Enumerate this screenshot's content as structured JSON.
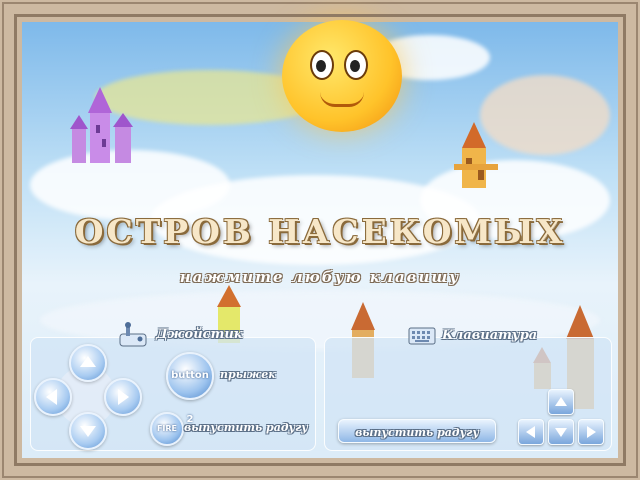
{
  "title": "ОСТРОВ НАСЕКОМЫХ",
  "subtitle": "нажмите любую клавишу",
  "joystick": {
    "heading": "Джойстик",
    "jump_button": "button 2",
    "jump_label": "прыжек",
    "fire_button": "FIRE",
    "fire_label": "выпустить радугу"
  },
  "keyboard": {
    "heading": "Клавиатура",
    "fire_button_label": "выпустить радугу"
  },
  "icons": {
    "joystick": "joystick-icon",
    "keyboard": "keyboard-icon",
    "sun": "sun-character",
    "castle": "castle-icon"
  },
  "colors": {
    "frame": "#cdb9a1",
    "title_fill": "#f7e7c8",
    "title_outline": "#8a6a3b",
    "panel": "#d2e4f6",
    "button": "#4c85c9"
  }
}
